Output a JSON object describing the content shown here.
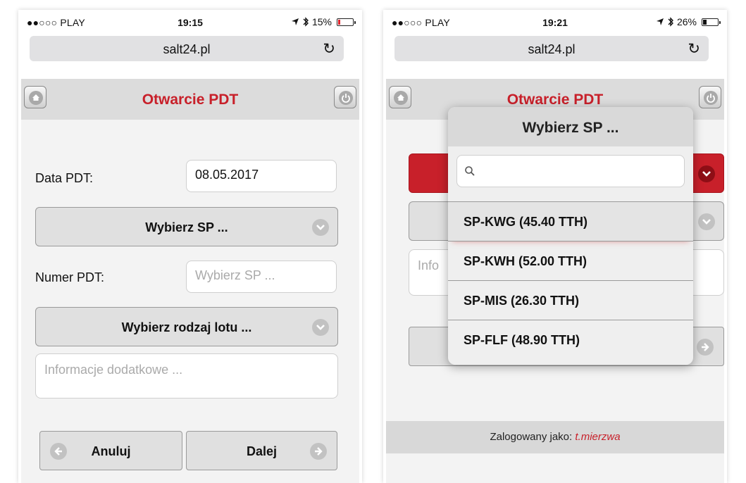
{
  "left": {
    "status": {
      "carrier": "●●○○○ PLAY",
      "time": "19:15",
      "battery": "15%",
      "battery_level": 0.15
    },
    "url": "salt24.pl",
    "header_title": "Otwarcie PDT",
    "date_label": "Data PDT:",
    "date_value": "08.05.2017",
    "select_sp": "Wybierz SP ...",
    "number_label": "Numer PDT:",
    "number_placeholder": "Wybierz SP ...",
    "select_flight_type": "Wybierz rodzaj lotu ...",
    "notes_placeholder": "Informacje dodatkowe ...",
    "cancel_label": "Anuluj",
    "next_label": "Dalej"
  },
  "right": {
    "status": {
      "carrier": "●●○○○ PLAY",
      "time": "19:21",
      "battery": "26%",
      "battery_level": 0.26
    },
    "url": "salt24.pl",
    "header_title": "Otwarcie PDT",
    "notes_placeholder_partial": "Info",
    "footer_prefix": "Zalogowany jako:",
    "footer_user": "t.mierzwa",
    "popup": {
      "title": "Wybierz SP ...",
      "options": [
        "SP-KWG (45.40 TTH)",
        "SP-KWH (52.00 TTH)",
        "SP-MIS (26.30 TTH)",
        "SP-FLF (48.90 TTH)"
      ],
      "selected_index": 0
    }
  },
  "colors": {
    "accent": "#c8202a",
    "header_bg": "#dcdcdc",
    "button_bg": "#e0e0e0"
  },
  "icons": [
    "home-icon",
    "power-icon",
    "chevron-down-icon",
    "arrow-left-icon",
    "arrow-right-icon",
    "search-icon",
    "reload-icon",
    "wifi-icon",
    "location-icon",
    "bluetooth-icon",
    "battery-icon"
  ]
}
